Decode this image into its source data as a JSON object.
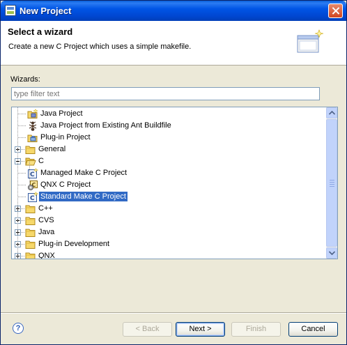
{
  "window": {
    "title": "New Project"
  },
  "header": {
    "title": "Select a wizard",
    "description": "Create a new C Project which uses a simple makefile."
  },
  "filter": {
    "label": "Wizards:",
    "placeholder": "type filter text",
    "value": "type filter text"
  },
  "tree": {
    "items": [
      {
        "label": "Java Project",
        "icon": "java-project-icon",
        "depth": 1,
        "expander": "none"
      },
      {
        "label": "Java Project from Existing Ant Buildfile",
        "icon": "ant-icon",
        "depth": 1,
        "expander": "none"
      },
      {
        "label": "Plug-in Project",
        "icon": "plugin-project-icon",
        "depth": 1,
        "expander": "none"
      },
      {
        "label": "General",
        "icon": "folder-icon",
        "depth": 0,
        "expander": "plus"
      },
      {
        "label": "C",
        "icon": "folder-open-icon",
        "depth": 0,
        "expander": "minus"
      },
      {
        "label": "Managed Make C Project",
        "icon": "c-project-icon",
        "depth": 1,
        "expander": "none"
      },
      {
        "label": "QNX C Project",
        "icon": "qnx-c-project-icon",
        "depth": 1,
        "expander": "none"
      },
      {
        "label": "Standard Make C Project",
        "icon": "c-project-icon",
        "depth": 1,
        "expander": "none",
        "selected": true
      },
      {
        "label": "C++",
        "icon": "folder-icon",
        "depth": 0,
        "expander": "plus"
      },
      {
        "label": "CVS",
        "icon": "folder-icon",
        "depth": 0,
        "expander": "plus"
      },
      {
        "label": "Java",
        "icon": "folder-icon",
        "depth": 0,
        "expander": "plus"
      },
      {
        "label": "Plug-in Development",
        "icon": "folder-icon",
        "depth": 0,
        "expander": "plus"
      },
      {
        "label": "QNX",
        "icon": "folder-icon",
        "depth": 0,
        "expander": "plus"
      }
    ]
  },
  "buttons": {
    "back": "< Back",
    "next": "Next >",
    "finish": "Finish",
    "cancel": "Cancel",
    "help": "?"
  },
  "colors": {
    "selection": "#316ac5",
    "titlebar": "#0055e5",
    "dialog_bg": "#ece9d8"
  }
}
